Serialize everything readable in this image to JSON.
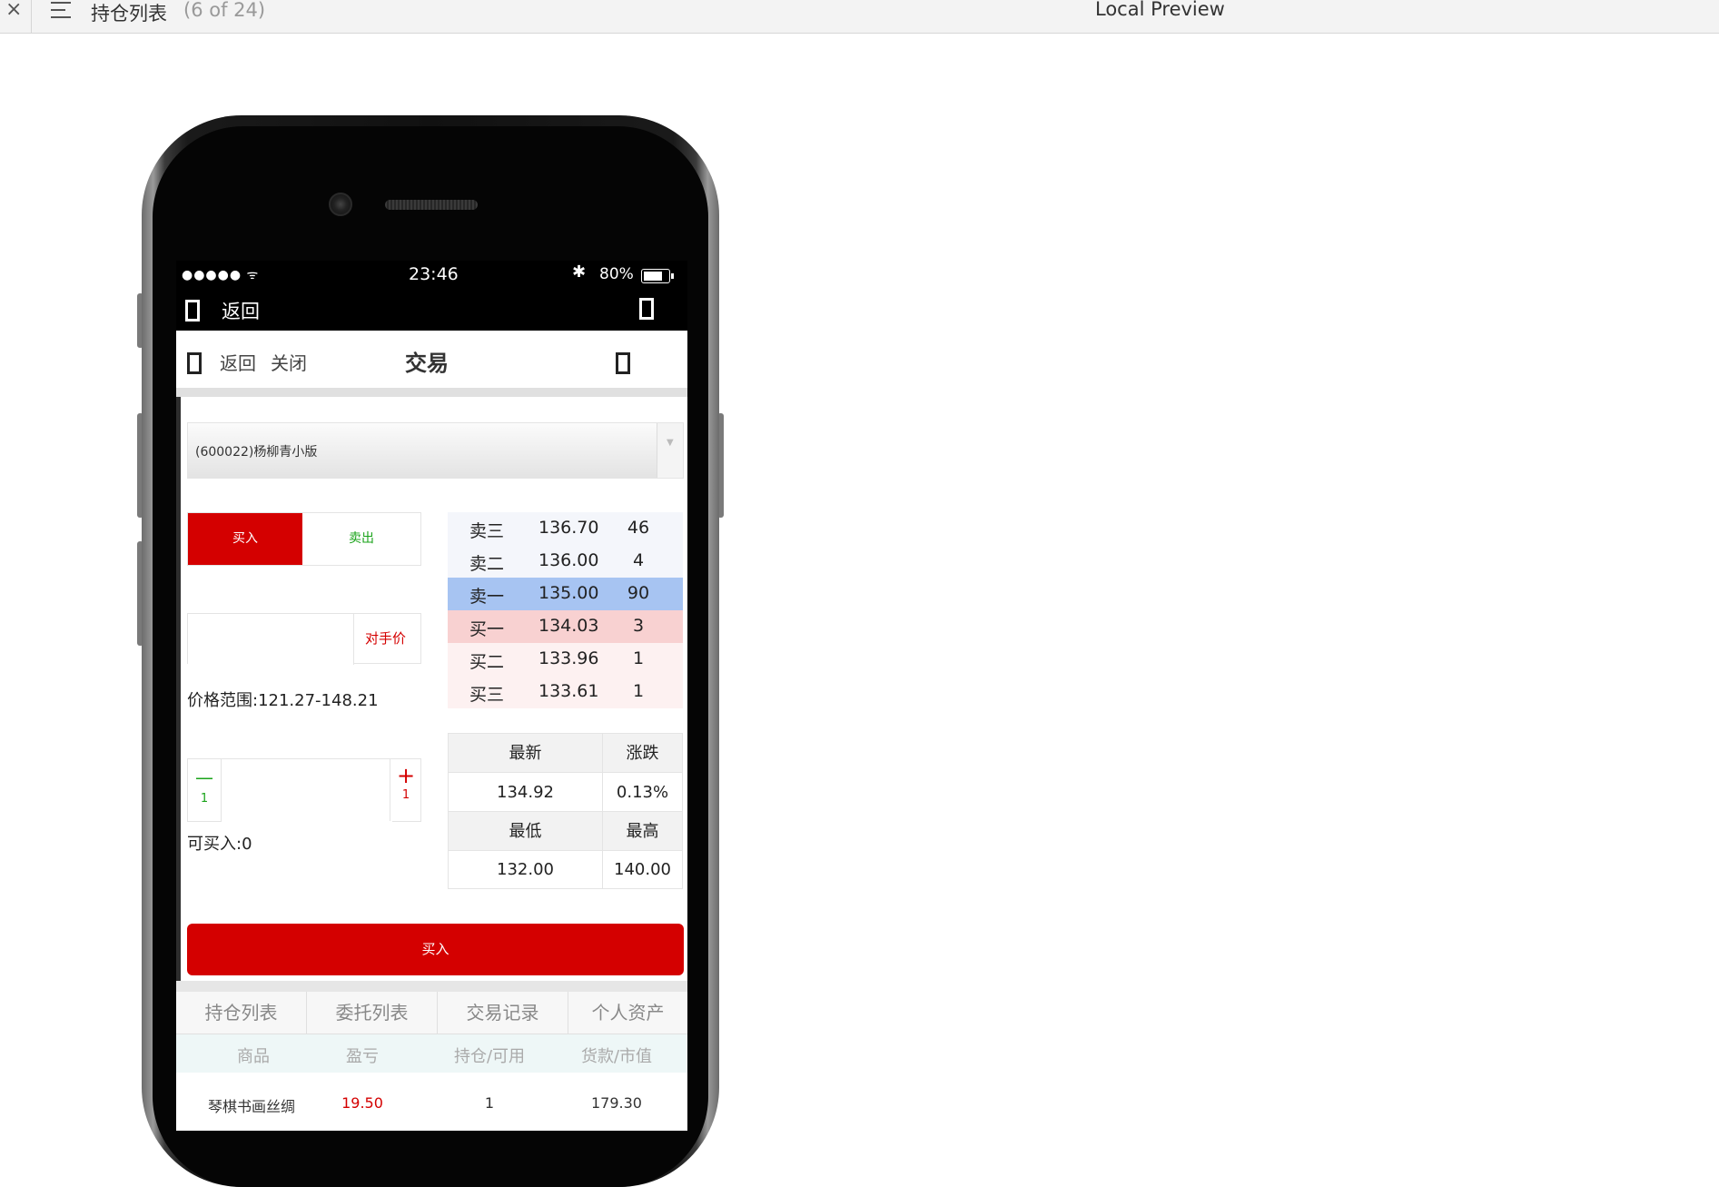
{
  "window": {
    "close_glyph": "×",
    "title": "持仓列表",
    "count": "(6 of 24)",
    "preview_label": "Local Preview"
  },
  "status_bar": {
    "signal": "●●●●● ᯤ",
    "time": "23:46",
    "bluetooth": "✱",
    "battery": "80%"
  },
  "nav_black": {
    "back_label": "返回"
  },
  "header": {
    "back_label": "返回",
    "close_label": "关闭",
    "title": "交易"
  },
  "product_select": {
    "value": "(600022)杨柳青小版",
    "arrow": "▼"
  },
  "trade_tabs": {
    "buy": "买入",
    "sell": "卖出"
  },
  "price": {
    "input_value": "",
    "opponent_price": "对手价",
    "range_label": "价格范围:121.27-148.21"
  },
  "quantity": {
    "minus_symbol": "—",
    "minus_step": "1",
    "plus_symbol": "+",
    "plus_step": "1",
    "input_value": "",
    "can_buy": "可买入:0"
  },
  "order_book": [
    {
      "label": "卖三",
      "price": "136.70",
      "volume": "46",
      "bg": "#f4f6fb"
    },
    {
      "label": "卖二",
      "price": "136.00",
      "volume": "4",
      "bg": "#f4f6fb"
    },
    {
      "label": "卖一",
      "price": "135.00",
      "volume": "90",
      "bg": "#a7c4f2"
    },
    {
      "label": "买一",
      "price": "134.03",
      "volume": "3",
      "bg": "#f8d1d1"
    },
    {
      "label": "买二",
      "price": "133.96",
      "volume": "1",
      "bg": "#fdf1f1"
    },
    {
      "label": "买三",
      "price": "133.61",
      "volume": "1",
      "bg": "#fdf1f1"
    }
  ],
  "quote": {
    "latest_label": "最新",
    "change_label": "涨跌",
    "latest_value": "134.92",
    "change_value": "0.13%",
    "low_label": "最低",
    "high_label": "最高",
    "low_value": "132.00",
    "high_value": "140.00"
  },
  "buy_button": "买入",
  "bottom_tabs": [
    "持仓列表",
    "委托列表",
    "交易记录",
    "个人资产"
  ],
  "positions_table": {
    "columns": [
      "商品",
      "盈亏",
      "持仓/可用",
      "货款/市值"
    ],
    "rows": [
      {
        "name": "琴棋书画丝绸",
        "pnl": "19.50",
        "holding": "1",
        "value": "179.30"
      }
    ]
  },
  "colors": {
    "accent_red": "#d40000",
    "sell_green": "#1aa31a",
    "ask1_blue": "#a7c4f2",
    "bid1_pink": "#f8d1d1"
  }
}
